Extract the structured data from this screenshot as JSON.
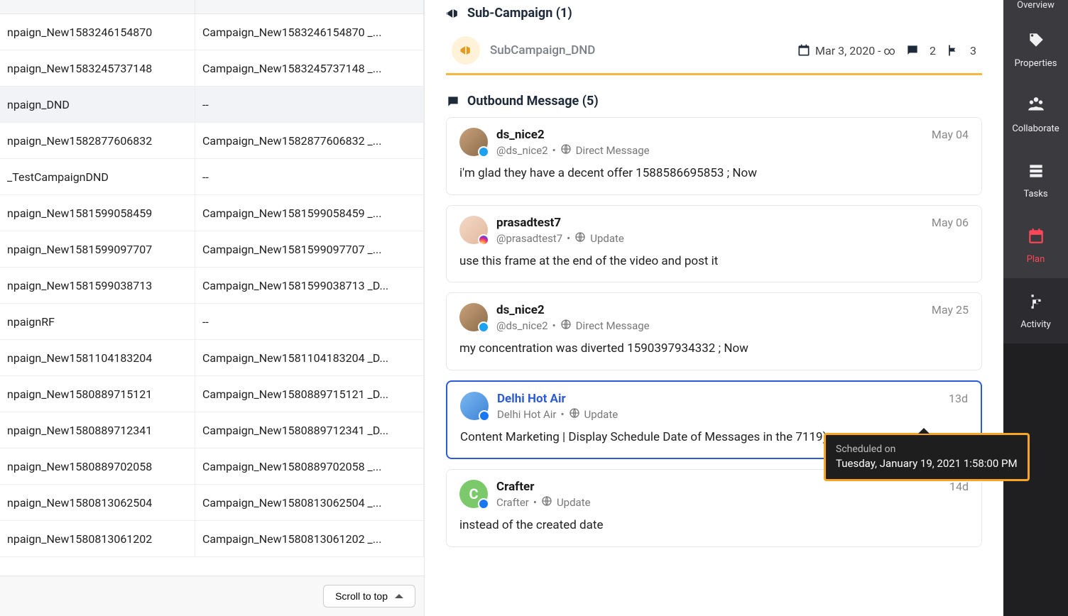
{
  "table": {
    "rows": [
      {
        "c1": "npaign_New1583246154870",
        "c2": "Campaign_New1583246154870 _..."
      },
      {
        "c1": "npaign_New1583245737148",
        "c2": "Campaign_New1583245737148 _..."
      },
      {
        "c1": "npaign_DND",
        "c2": "--",
        "selected": true
      },
      {
        "c1": "npaign_New1582877606832",
        "c2": "Campaign_New1582877606832 _..."
      },
      {
        "c1": "_TestCampaignDND",
        "c2": "--"
      },
      {
        "c1": "npaign_New1581599058459",
        "c2": "Campaign_New1581599058459 _..."
      },
      {
        "c1": "npaign_New1581599097707",
        "c2": "Campaign_New1581599097707 _..."
      },
      {
        "c1": "npaign_New1581599038713",
        "c2": "Campaign_New1581599038713 _D..."
      },
      {
        "c1": "npaignRF",
        "c2": "--"
      },
      {
        "c1": "npaign_New1581104183204",
        "c2": "Campaign_New1581104183204 _D..."
      },
      {
        "c1": "npaign_New1580889715121",
        "c2": "Campaign_New1580889715121 _D..."
      },
      {
        "c1": "npaign_New1580889712341",
        "c2": "Campaign_New1580889712341 _D..."
      },
      {
        "c1": "npaign_New1580889702058",
        "c2": "Campaign_New1580889702058 _..."
      },
      {
        "c1": "npaign_New1580813062504",
        "c2": "Campaign_New1580813062504 _..."
      },
      {
        "c1": "npaign_New1580813061202",
        "c2": "Campaign_New1580813061202 _..."
      }
    ],
    "scroll_top": "Scroll to top"
  },
  "detail": {
    "subcampaign": {
      "title": "Sub-Campaign (1)",
      "name": "SubCampaign_DND",
      "date": "Mar 3, 2020 - ∞",
      "msg_count": "2",
      "flag_count": "3"
    },
    "outbound": {
      "title": "Outbound Message (5)",
      "messages": [
        {
          "user": "ds_nice2",
          "handle": "@ds_nice2",
          "channel": "Direct Message",
          "when": "May 04",
          "body": "i'm glad they have a decent offer 1588586695853 ; Now",
          "avatar": "brown",
          "badge": "tw"
        },
        {
          "user": "prasadtest7",
          "handle": "@prasadtest7",
          "channel": "Update",
          "when": "May 06",
          "body": "use this frame at the end of the video and post it",
          "avatar": "pale",
          "badge": "ig"
        },
        {
          "user": "ds_nice2",
          "handle": "@ds_nice2",
          "channel": "Direct Message",
          "when": "May 25",
          "body": "my concentration was diverted 1590397934332 ; Now",
          "avatar": "brown",
          "badge": "tw"
        },
        {
          "user": "Delhi Hot Air",
          "handle": "Delhi Hot Air",
          "channel": "Update",
          "when": "13d",
          "body": "Content Marketing | Display Schedule Date of Messages in the 7119)",
          "avatar": "blue",
          "badge": "fb",
          "selected": true,
          "link": true
        },
        {
          "user": "Crafter",
          "handle": "Crafter",
          "channel": "Update",
          "when": "14d",
          "body": "instead of the created date",
          "avatar": "green",
          "initial": "C",
          "badge": "fb"
        }
      ]
    }
  },
  "tooltip": {
    "label": "Scheduled on",
    "value": "Tuesday, January 19, 2021 1:58:00 PM"
  },
  "sidebar": {
    "items": [
      {
        "label": "Overview"
      },
      {
        "label": "Properties"
      },
      {
        "label": "Collaborate"
      },
      {
        "label": "Tasks"
      },
      {
        "label": "Plan",
        "active": true
      },
      {
        "label": "Activity",
        "dark": true
      }
    ]
  }
}
